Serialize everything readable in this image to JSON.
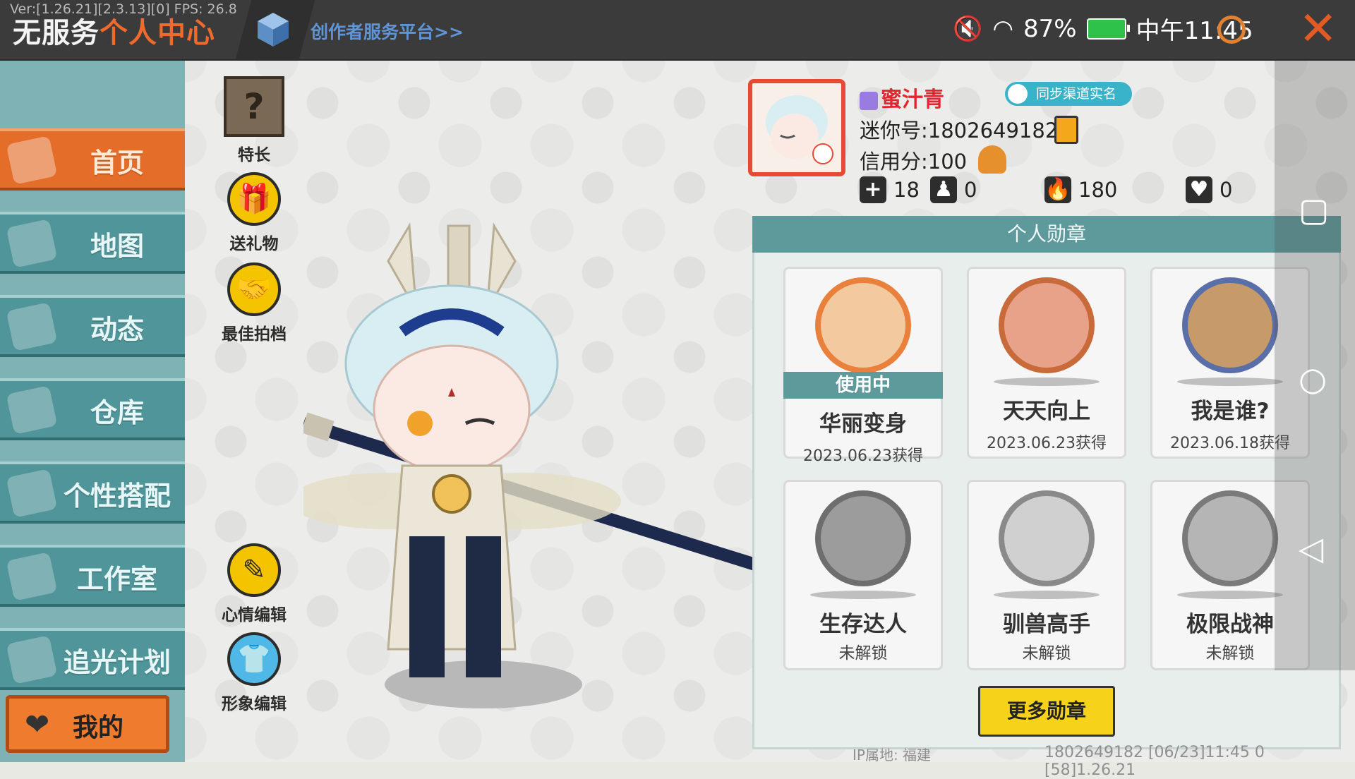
{
  "topbar": {
    "version": "Ver:[1.26.21][2.3.13][0] FPS: 26.8",
    "title_prefix": "无服务",
    "title_highlight": "个人中心",
    "creator_link": "创作者服务平台>>",
    "battery": "87%",
    "time": "中午11:45"
  },
  "nav": {
    "items": [
      {
        "label": "首页",
        "active": true
      },
      {
        "label": "地图"
      },
      {
        "label": "动态"
      },
      {
        "label": "仓库"
      },
      {
        "label": "个性搭配"
      },
      {
        "label": "工作室"
      },
      {
        "label": "追光计划"
      }
    ],
    "mine": "我的"
  },
  "tools": {
    "specialty": "特长",
    "send_gift": "送礼物",
    "best_partner": "最佳拍档",
    "mood_edit": "心情编辑",
    "look_edit": "形象编辑"
  },
  "profile": {
    "name": "蜜汁青",
    "sync_label": "同步渠道实名",
    "mini_id": "迷你号:1802649182",
    "credit": "信用分:100",
    "stats": {
      "add": "18",
      "fans": "0",
      "popularity": "180",
      "likes": "0"
    }
  },
  "medals": {
    "header": "个人勋章",
    "in_use_label": "使用中",
    "items": [
      {
        "name": "华丽变身",
        "sub": "2023.06.23获得",
        "in_use": true,
        "color": "#e9803c"
      },
      {
        "name": "天天向上",
        "sub": "2023.06.23获得",
        "color": "#c96a3a"
      },
      {
        "name": "我是谁?",
        "sub": "2023.06.18获得",
        "color": "#5a6ea8"
      },
      {
        "name": "生存达人",
        "sub": "未解锁",
        "color": "#6e6e6e"
      },
      {
        "name": "驯兽高手",
        "sub": "未解锁",
        "color": "#8a8a8a"
      },
      {
        "name": "极限战神",
        "sub": "未解锁",
        "color": "#7a7a7a"
      }
    ],
    "more_button": "更多勋章"
  },
  "footer": {
    "ip": "IP属地: 福建",
    "right": "1802649182   [06/23]11:45 0   [58]1.26.21"
  }
}
